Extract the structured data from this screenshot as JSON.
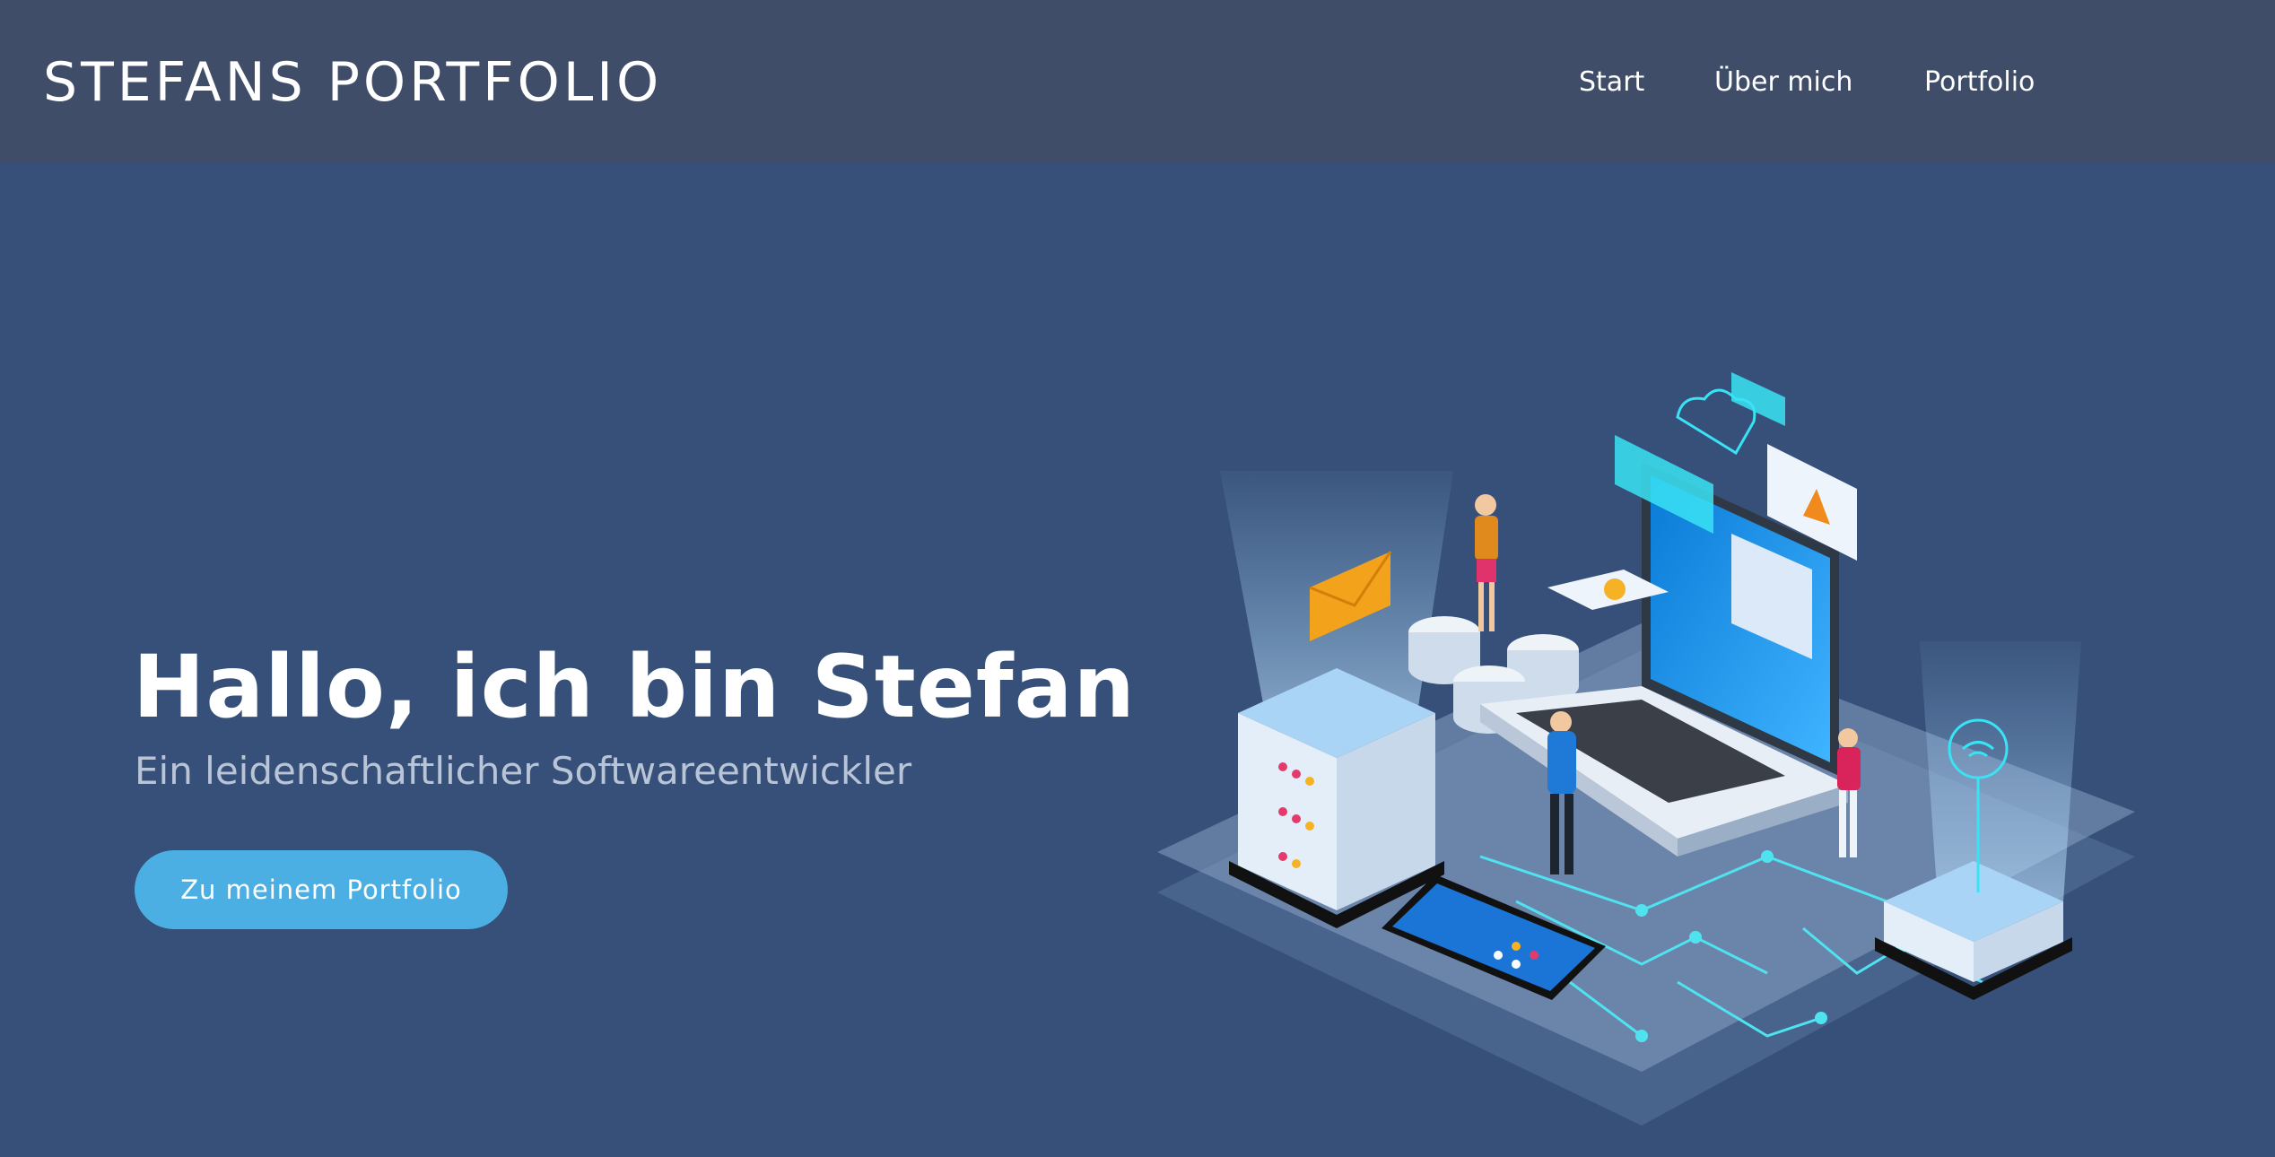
{
  "header": {
    "brand": "STEFANS PORTFOLIO",
    "nav": [
      "Start",
      "Über mich",
      "Portfolio"
    ]
  },
  "hero": {
    "title": "Hallo, ich bin Stefan",
    "subtitle": "Ein leidenschaftlicher Softwareentwickler",
    "cta_label": "Zu meinem Portfolio"
  },
  "colors": {
    "header_bg": "#3f4d69",
    "page_bg": "#365079",
    "accent": "#4bafe3"
  }
}
